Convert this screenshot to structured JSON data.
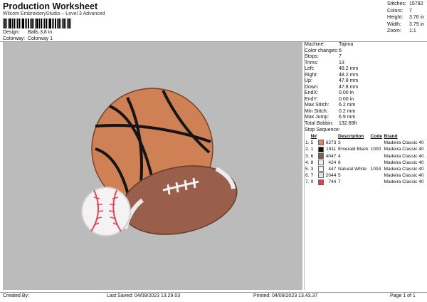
{
  "header": {
    "title": "Production Worksheet",
    "subtitle": "Wilcom EmbroideryStudio – Level 3 Advanced",
    "design_label": "Design:",
    "design_value": "Balls 3,8 in",
    "colorway_label": "Colorway:",
    "colorway_value": "Colorway 1"
  },
  "summary": {
    "stitches_label": "Stitches:",
    "stitches_value": "15792",
    "colors_label": "Colors:",
    "colors_value": "7",
    "height_label": "Height:",
    "height_value": "3.76 in",
    "width_label": "Width:",
    "width_value": "3.79 in",
    "zoom_label": "Zoom:",
    "zoom_value": "1:1"
  },
  "props": [
    {
      "k": "Machine:",
      "v": "Tajima"
    },
    {
      "k": "Color changes:",
      "v": "6"
    },
    {
      "k": "Stops:",
      "v": "7"
    },
    {
      "k": "Trims:",
      "v": "13"
    },
    {
      "k": "Left:",
      "v": "48.2 mm"
    },
    {
      "k": "Right:",
      "v": "48.2 mm"
    },
    {
      "k": "Up:",
      "v": "47.8 mm"
    },
    {
      "k": "Down:",
      "v": "47.8 mm"
    },
    {
      "k": "EndX:",
      "v": "0.00 in"
    },
    {
      "k": "EndY:",
      "v": "0.00 in"
    },
    {
      "k": "Max Stitch:",
      "v": "6.2 mm"
    },
    {
      "k": "Min Stitch:",
      "v": "0.2 mm"
    },
    {
      "k": "Max Jump:",
      "v": "6.9 mm"
    },
    {
      "k": "Total Bobbin:",
      "v": "132.69ft"
    }
  ],
  "sequence": {
    "label": "Stop Sequence:",
    "headers": {
      "n": "N#",
      "desc": "Description",
      "code": "Code",
      "brand": "Brand"
    },
    "rows": [
      {
        "order": "1.",
        "n": "5",
        "color": "#e0866b",
        "code_num": "6273",
        "desc": "3",
        "code": "",
        "brand": "Madeira Classic 40"
      },
      {
        "order": "2.",
        "n": "1",
        "color": "#111111",
        "code_num": "1811",
        "desc": "Emerald Black",
        "code": "1000",
        "brand": "Madeira Classic 40"
      },
      {
        "order": "3.",
        "n": "6",
        "color": "#8a5a4e",
        "code_num": "4047",
        "desc": "4",
        "code": "",
        "brand": "Madeira Classic 40"
      },
      {
        "order": "4.",
        "n": "8",
        "color": "#f4f0f2",
        "code_num": "424",
        "desc": "6",
        "code": "",
        "brand": "Madeira Classic 40"
      },
      {
        "order": "5.",
        "n": "3",
        "color": "#f5f5f5",
        "code_num": "447",
        "desc": "Natural White",
        "code": "1004",
        "brand": "Madeira Classic 40"
      },
      {
        "order": "6.",
        "n": "7",
        "color": "#e2e2e2",
        "code_num": "2044",
        "desc": "5",
        "code": "",
        "brand": "Madeira Classic 40"
      },
      {
        "order": "7.",
        "n": "9",
        "color": "#e8394f",
        "code_num": "744",
        "desc": "7",
        "code": "",
        "brand": "Madeira Classic 40"
      }
    ]
  },
  "footer": {
    "created_by": "Created By:",
    "last_saved": "Last Saved: 04/09/2023 13.29.03",
    "printed": "Printed: 04/09/2023 13.43.37",
    "page": "Page 1 of 1"
  }
}
